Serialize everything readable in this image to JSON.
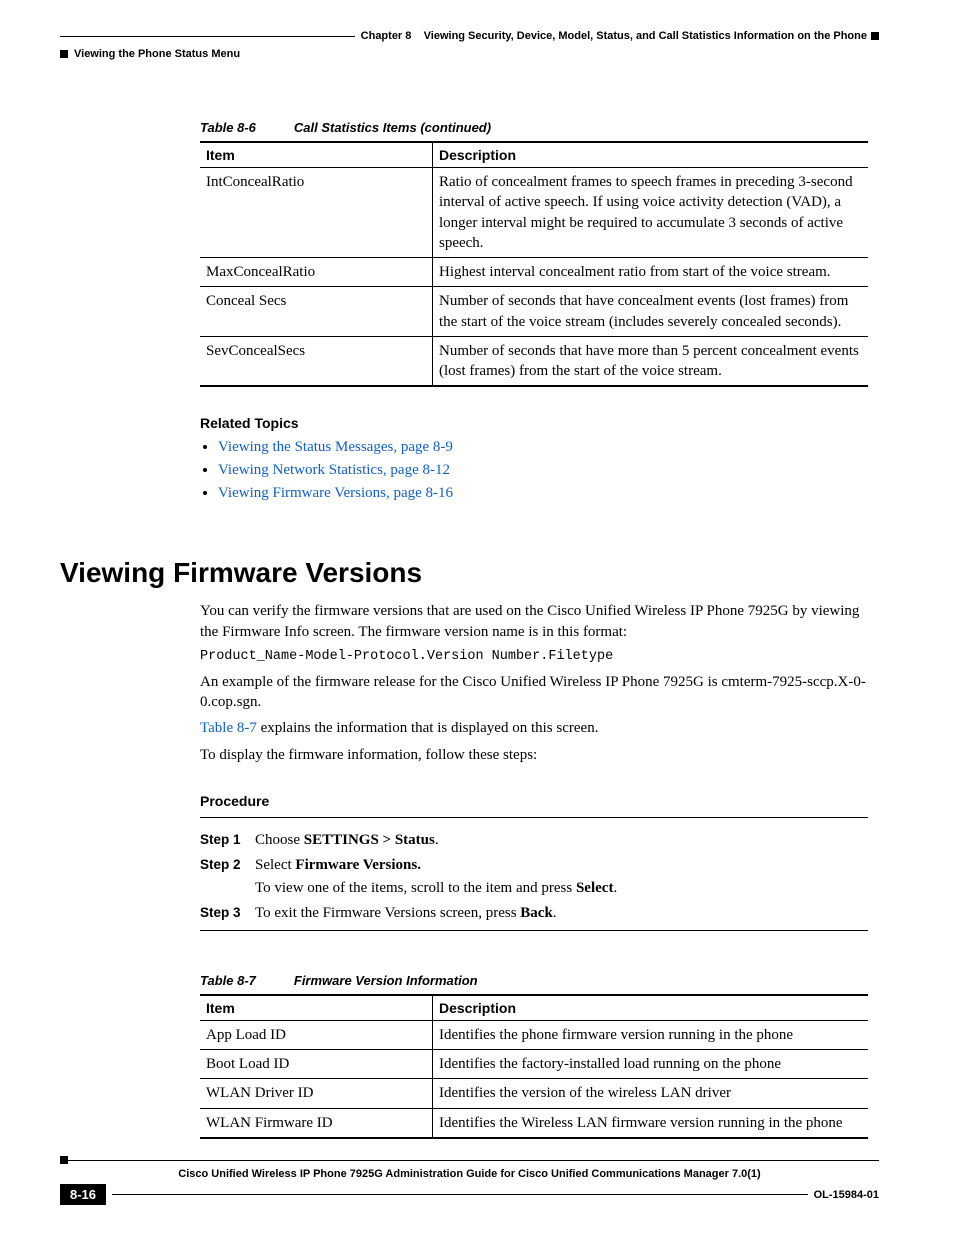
{
  "header": {
    "chapter_label": "Chapter 8",
    "chapter_title": "Viewing Security, Device, Model, Status, and Call Statistics Information on the Phone",
    "section_header": "Viewing the Phone Status Menu"
  },
  "table86": {
    "caption_num": "Table 8-6",
    "caption_title": "Call Statistics Items (continued)",
    "header_item": "Item",
    "header_desc": "Description",
    "rows": [
      {
        "item": "IntConcealRatio",
        "desc": "Ratio of concealment frames to speech frames in preceding 3-second interval of active speech. If using voice activity detection (VAD), a longer interval might be required to accumulate 3 seconds of active speech."
      },
      {
        "item": "MaxConcealRatio",
        "desc": "Highest interval concealment ratio from start of the voice stream."
      },
      {
        "item": "Conceal Secs",
        "desc": "Number of seconds that have concealment events (lost frames) from the start of the voice stream (includes severely concealed seconds)."
      },
      {
        "item": "SevConcealSecs",
        "desc": "Number of seconds that have more than 5 percent concealment events (lost frames) from the start of the voice stream."
      }
    ]
  },
  "related": {
    "heading": "Related Topics",
    "items": [
      "Viewing the Status Messages, page 8-9",
      "Viewing Network Statistics, page 8-12",
      "Viewing Firmware Versions, page 8-16"
    ]
  },
  "section": {
    "title": "Viewing Firmware Versions",
    "p1": "You can verify the firmware versions that are used on the Cisco Unified Wireless IP Phone 7925G by viewing the Firmware Info screen. The firmware version name is in this format:",
    "code": "Product_Name-Model-Protocol.Version Number.Filetype",
    "p2": "An example of the firmware release for the Cisco Unified Wireless IP Phone 7925G is cmterm-7925-sccp.X-0-0.cop.sgn.",
    "p3_link": "Table 8-7",
    "p3_rest": " explains the information that is displayed on this screen.",
    "p4": "To display the firmware information, follow these steps:"
  },
  "procedure": {
    "heading": "Procedure",
    "steps": [
      {
        "label": "Step 1",
        "html": "Choose <b>SETTINGS > Status</b>."
      },
      {
        "label": "Step 2",
        "html": "Select <b>Firmware Versions.</b>",
        "sub": "To view one of the items, scroll to the item and press <b>Select</b>."
      },
      {
        "label": "Step 3",
        "html": "To exit the Firmware Versions screen, press <b>Back</b>."
      }
    ]
  },
  "table87": {
    "caption_num": "Table 8-7",
    "caption_title": "Firmware Version Information",
    "header_item": "Item",
    "header_desc": "Description",
    "rows": [
      {
        "item": "App Load ID",
        "desc": "Identifies the phone firmware version running in the phone"
      },
      {
        "item": "Boot Load ID",
        "desc": "Identifies the factory-installed load running on the phone"
      },
      {
        "item": "WLAN Driver ID",
        "desc": "Identifies the version of the wireless LAN driver"
      },
      {
        "item": "WLAN Firmware ID",
        "desc": "Identifies the Wireless LAN firmware version running in the phone"
      }
    ]
  },
  "footer": {
    "title": "Cisco Unified Wireless IP Phone 7925G Administration Guide for Cisco Unified Communications Manager 7.0(1)",
    "page": "8-16",
    "docid": "OL-15984-01"
  }
}
